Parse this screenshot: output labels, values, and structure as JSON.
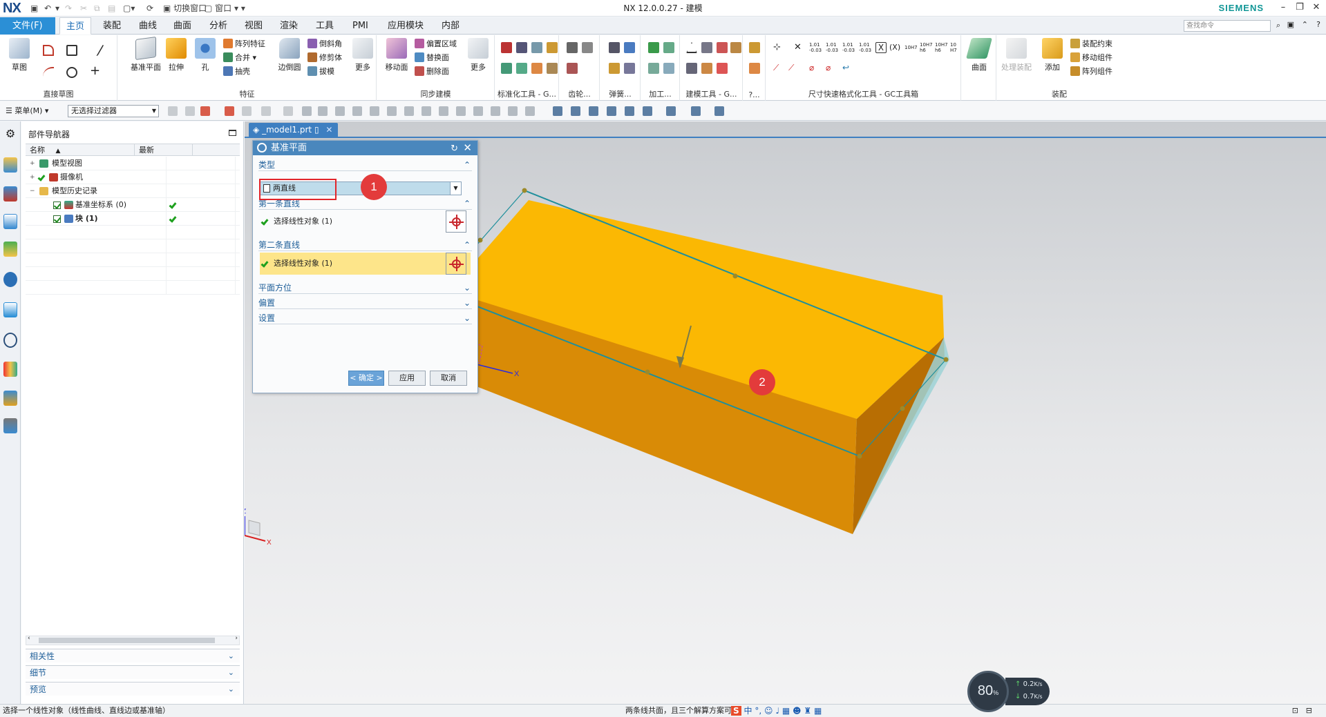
{
  "window": {
    "logo": "NX",
    "title": "NX 12.0.0.27 - 建模",
    "brand": "SIEMENS",
    "quick_access": {
      "switch_window": "切换窗口",
      "window_menu": "窗口"
    }
  },
  "ribbon_tabs": [
    "文件(F)",
    "主页",
    "装配",
    "曲线",
    "曲面",
    "分析",
    "视图",
    "渲染",
    "工具",
    "PMI",
    "应用模块",
    "内部"
  ],
  "command_search": {
    "placeholder": "查找命令"
  },
  "ribbon": {
    "direct_sketch": {
      "label": "直接草图",
      "sketch": "草图"
    },
    "feature": {
      "label": "特征",
      "datum_plane": "基准平面",
      "extrude": "拉伸",
      "hole": "孔",
      "pattern_feature": "阵列特征",
      "unite": "合并",
      "shell": "抽壳",
      "edge_blend": "边倒圆",
      "chamfer": "倒斜角",
      "trim_body": "修剪体",
      "draft": "拔模",
      "more": "更多"
    },
    "sync_modeling": {
      "label": "同步建模",
      "move_face": "移动面",
      "offset_region": "偏置区域",
      "replace_face": "替换面",
      "delete_face": "删除面",
      "more": "更多"
    },
    "std_tools": "标准化工具 - G...",
    "gear": "齿轮...",
    "spring": "弹簧...",
    "machining": "加工...",
    "modeling_tools": "建模工具 - G...",
    "more_groups": "?...",
    "dim_tools": "尺寸快速格式化工具 - GC工具箱",
    "surface": {
      "label": "曲面"
    },
    "assembly": {
      "label": "装配",
      "process_assembly": "处理装配",
      "add": "添加",
      "assembly_constraint": "装配约束",
      "move_component": "移动组件",
      "pattern_component": "阵列组件"
    }
  },
  "selection_bar": {
    "menu": "菜单(M)",
    "filter": "无选择过滤器"
  },
  "navigator": {
    "title": "部件导航器",
    "columns": {
      "name": "名称",
      "latest": "最新"
    },
    "rows": [
      {
        "label": "模型视图"
      },
      {
        "label": "摄像机"
      },
      {
        "label": "模型历史记录"
      },
      {
        "label": "基准坐标系 (0)"
      },
      {
        "label": "块 (1)"
      }
    ],
    "sections": [
      "相关性",
      "细节",
      "预览"
    ]
  },
  "document_tab": {
    "name": "_model1.prt"
  },
  "dialog": {
    "title": "基准平面",
    "type_section": "类型",
    "type_value": "两直线",
    "first_line_section": "第一条直线",
    "first_line_select": "选择线性对象 (1)",
    "second_line_section": "第二条直线",
    "second_line_select": "选择线性对象 (1)",
    "plane_orientation": "平面方位",
    "offset": "偏置",
    "settings": "设置",
    "ok": "< 确定 >",
    "apply": "应用",
    "cancel": "取消"
  },
  "annotations": {
    "marker1": "1",
    "marker2": "2"
  },
  "viewport": {
    "axis_zc": "ZC",
    "axis_xc": "XC",
    "axis_x": "X",
    "axis_z": "Z",
    "triad_z": "Z",
    "triad_x": "X"
  },
  "status_bar": {
    "prompt": "选择一个线性对象（线性曲线、直线边或基准轴）",
    "message": "两条线共面，且三个解算方案可",
    "ime_lang": "中"
  },
  "network_widget": {
    "percent": "80",
    "percent_unit": "%",
    "up": "0.2",
    "down": "0.7",
    "rate_unit": "K/s"
  },
  "colors": {
    "ribbon_file_tab": "#2b8fd6",
    "dialog_title": "#4a87bd",
    "block_top": "#fbb803",
    "block_front": "#d98b06",
    "block_side": "#b86e03",
    "datum_plane": "#9ed2d6",
    "datum_edge": "#1f8f9c",
    "highlight_row": "#fde58a",
    "marker": "#e33b3b"
  }
}
